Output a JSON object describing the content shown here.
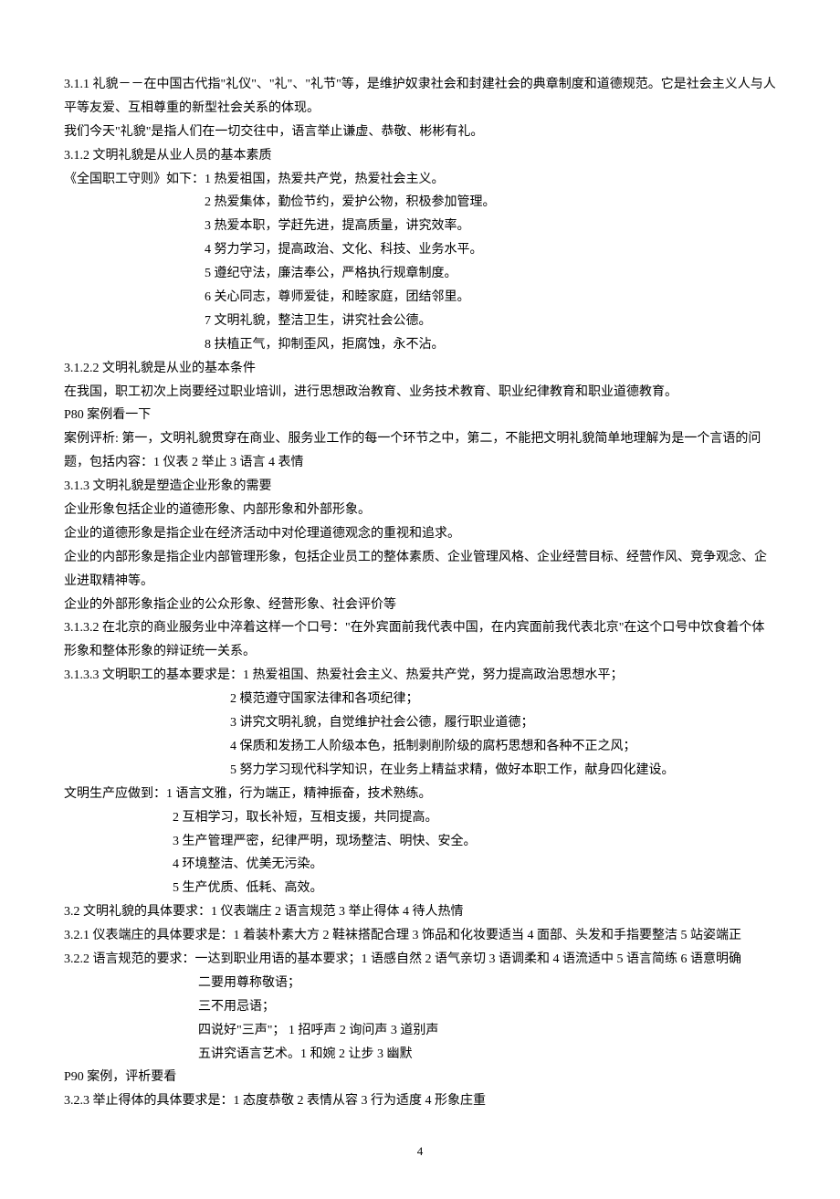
{
  "p1": "3.1.1 礼貌－－在中国古代指\"礼仪\"、\"礼\"、\"礼节\"等，是维护奴隶社会和封建社会的典章制度和道德规范。它是社会主义人与人平等友爱、互相尊重的新型社会关系的体现。",
  "p2": "我们今天\"礼貌\"是指人们在一切交往中，语言举止谦虚、恭敬、彬彬有礼。",
  "p3": "3.1.2 文明礼貌是从业人员的基本素质",
  "p4": "《全国职工守则》如下：1 热爱祖国，热爱共产党，热爱社会主义。",
  "p5": "2 热爱集体，勤俭节约，爱护公物，积极参加管理。",
  "p6": "3 热爱本职，学赶先进，提高质量，讲究效率。",
  "p7": "4 努力学习，提高政治、文化、科技、业务水平。",
  "p8": "5 遵纪守法，廉洁奉公，严格执行规章制度。",
  "p9": "6 关心同志，尊师爱徒，和睦家庭，团结邻里。",
  "p10": "7 文明礼貌，整洁卫生，讲究社会公德。",
  "p11": "8 扶植正气，抑制歪风，拒腐蚀，永不沾。",
  "p12": "3.1.2.2 文明礼貌是从业的基本条件",
  "p13": "在我国，职工初次上岗要经过职业培训，进行思想政治教育、业务技术教育、职业纪律教育和职业道德教育。",
  "p14": "P80 案例看一下",
  "p15": "案例评析: 第一，文明礼貌贯穿在商业、服务业工作的每一个环节之中，第二，不能把文明礼貌简单地理解为是一个言语的问题，包括内容：1 仪表 2 举止 3 语言 4 表情",
  "p16": "3.1.3 文明礼貌是塑造企业形象的需要",
  "p17": "企业形象包括企业的道德形象、内部形象和外部形象。",
  "p18": "企业的道德形象是指企业在经济活动中对伦理道德观念的重视和追求。",
  "p19": "企业的内部形象是指企业内部管理形象，包括企业员工的整体素质、企业管理风格、企业经营目标、经营作风、竞争观念、企业进取精神等。",
  "p20": "企业的外部形象指企业的公众形象、经营形象、社会评价等",
  "p21": "3.1.3.2 在北京的商业服务业中淬着这样一个口号：\"在外宾面前我代表中国，在内宾面前我代表北京\"在这个口号中饮食着个体形象和整体形象的辩证统一关系。",
  "p22": "3.1.3.3 文明职工的基本要求是：1 热爱祖国、热爱社会主义、热爱共产党，努力提高政治思想水平；",
  "p23": "2 模范遵守国家法律和各项纪律；",
  "p24": "3 讲究文明礼貌，自觉维护社会公德，履行职业道德；",
  "p25": "4 保质和发扬工人阶级本色，抵制剥削阶级的腐朽思想和各种不正之风；",
  "p26": "5 努力学习现代科学知识，在业务上精益求精，做好本职工作，献身四化建设。",
  "p27": "文明生产应做到：1 语言文雅，行为端正，精神振奋，技术熟练。",
  "p28": "2 互相学习，取长补短，互相支援，共同提高。",
  "p29": "3 生产管理严密，纪律严明，现场整洁、明快、安全。",
  "p30": "4 环境整洁、优美无污染。",
  "p31": "5 生产优质、低耗、高效。",
  "p32": "3.2 文明礼貌的具体要求：1 仪表端庄   2 语言规范   3 举止得体   4 待人热情",
  "p33": "3.2.1 仪表端庄的具体要求是：1 着装朴素大方 2 鞋袜搭配合理   3 饰品和化妆要适当   4 面部、头发和手指要整洁   5 站姿端正",
  "p34": "3.2.2 语言规范的要求：一达到职业用语的基本要求；1 语感自然 2 语气亲切 3 语调柔和 4 语流适中 5 语言简练 6 语意明确",
  "p35": "二要用尊称敬语；",
  "p36": "三不用忌语；",
  "p37": "四说好\"三声\"；   1 招呼声 2 询问声 3 道别声",
  "p38": "五讲究语言艺术。1 和婉 2 让步 3 幽默",
  "p39": "P90 案例，评析要看",
  "p40": "3.2.3 举止得体的具体要求是：1 态度恭敬   2 表情从容   3 行为适度   4 形象庄重",
  "pagenum": "4"
}
